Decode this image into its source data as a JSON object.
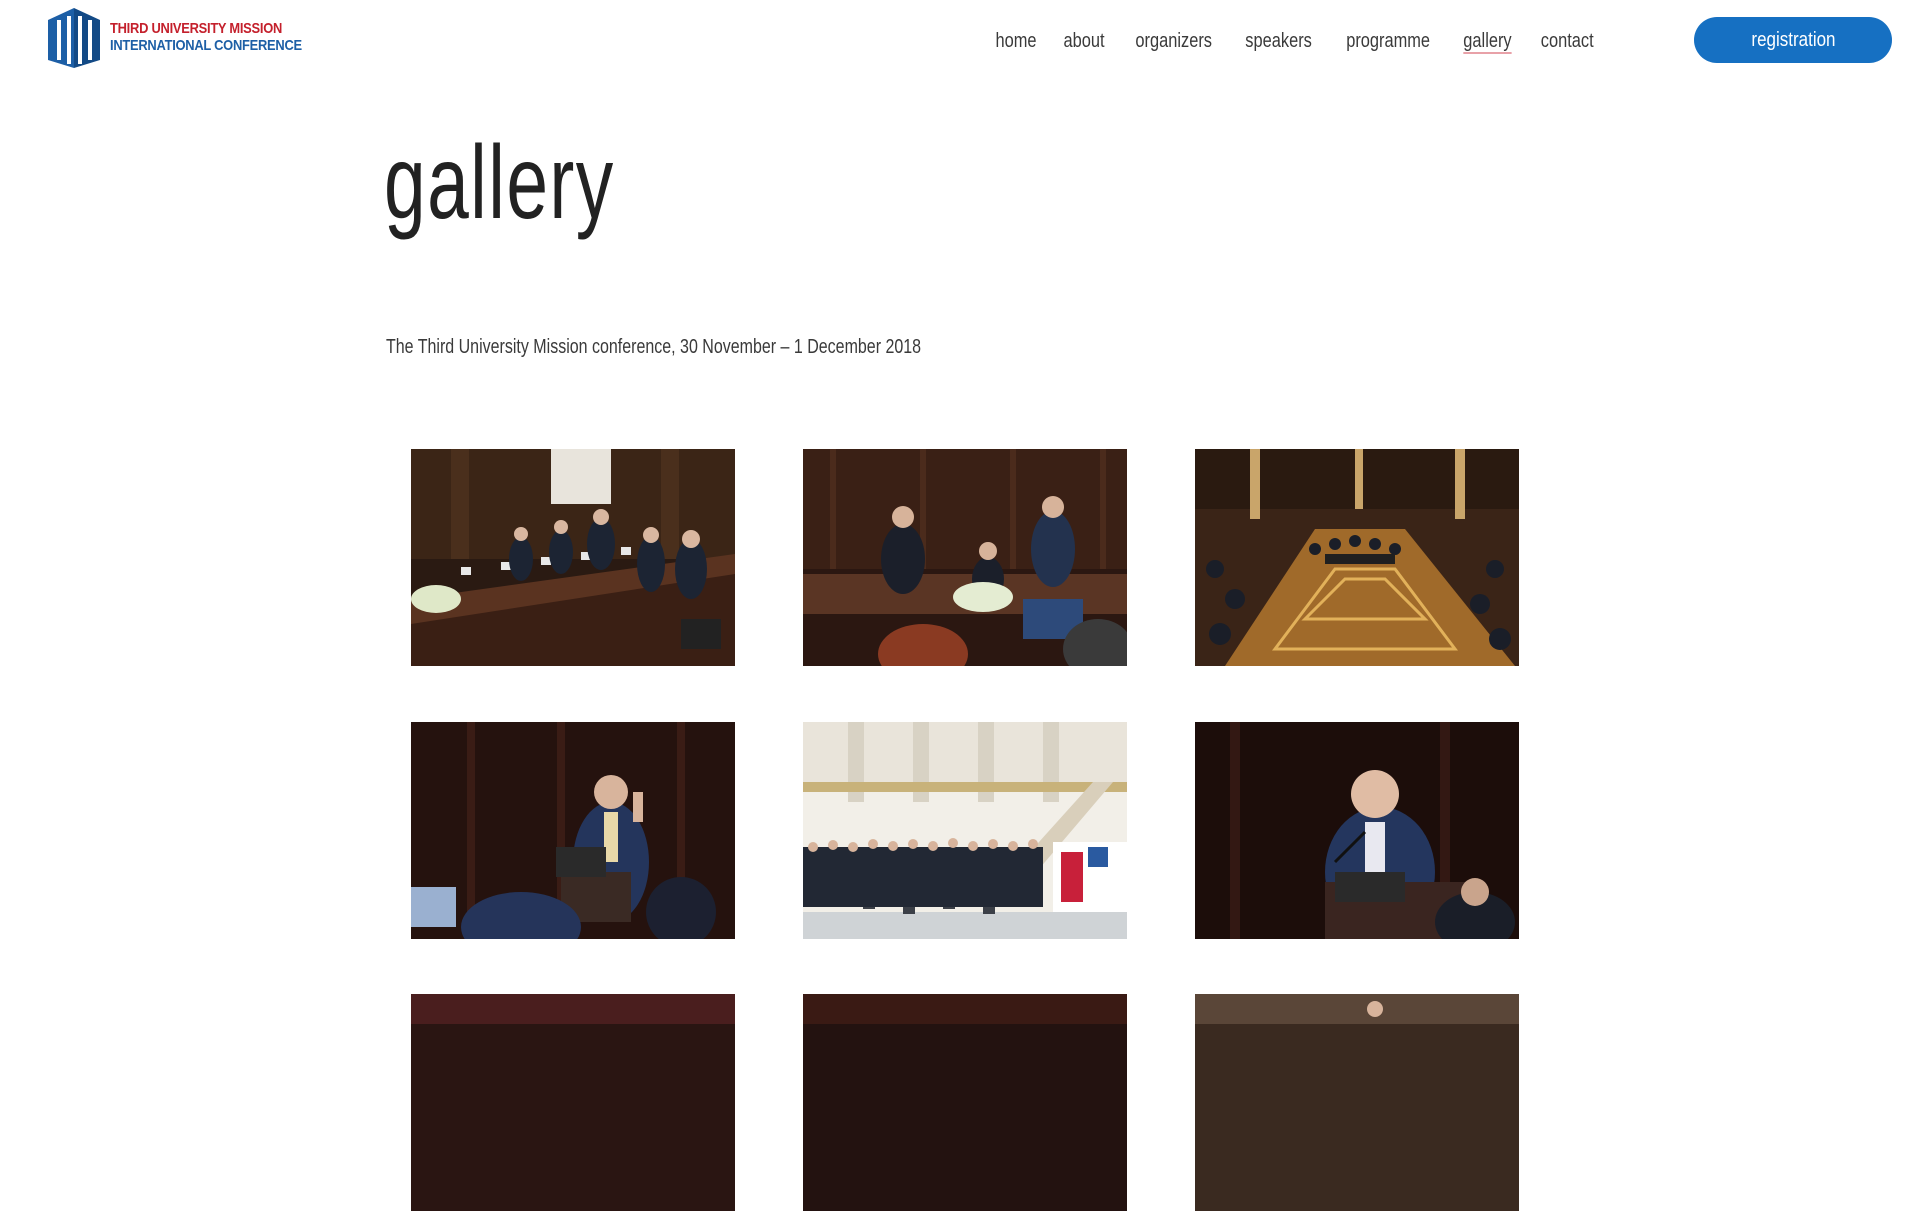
{
  "logo": {
    "line1": "THIRD  UNIVERSITY MISSION",
    "line2": "INTERNATIONAL CONFERENCE"
  },
  "nav": {
    "items": [
      {
        "label": "home"
      },
      {
        "label": "about"
      },
      {
        "label": "organizers"
      },
      {
        "label": "speakers"
      },
      {
        "label": "programme"
      },
      {
        "label": "gallery",
        "active": true
      },
      {
        "label": "contact"
      }
    ],
    "registration_label": "registration"
  },
  "page": {
    "title": "gallery",
    "subtitle": "The Third University Mission conference, 30 November – 1 December 2018"
  },
  "gallery": {
    "images": [
      {
        "icon": "conference-panel-photo"
      },
      {
        "icon": "speakers-podium-photo"
      },
      {
        "icon": "hall-overview-photo"
      },
      {
        "icon": "speaker-gesturing-photo"
      },
      {
        "icon": "group-photo"
      },
      {
        "icon": "speaker-microphone-photo"
      },
      {
        "icon": "photo-partial"
      },
      {
        "icon": "photo-partial"
      },
      {
        "icon": "photo-partial"
      }
    ]
  },
  "colors": {
    "brand_blue": "#1670c2",
    "logo_red": "#c4202c",
    "logo_blue": "#1d5fa6",
    "active_underline": "#e8a1a8"
  }
}
